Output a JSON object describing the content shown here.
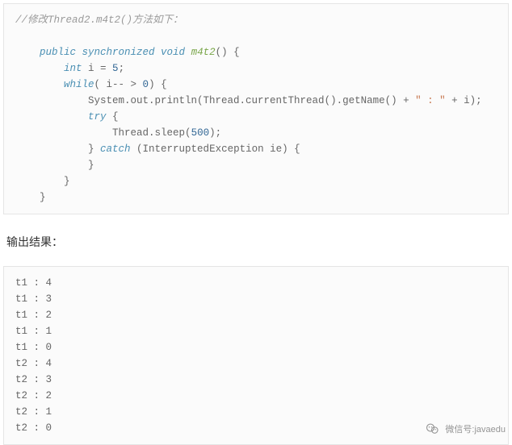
{
  "code_block_1": {
    "line1_comment": "//修改Thread2.m4t2()方法如下：",
    "sig_kw": "public synchronized void",
    "sig_fn": "m4t2",
    "sig_tail": "() {",
    "l2_kw": "int",
    "l2_rest": " i = ",
    "l2_num": "5",
    "l2_tail": ";",
    "l3_kw": "while",
    "l3_rest": "( i-- > ",
    "l3_num": "0",
    "l3_tail": ") {",
    "l4_text": "System.out.println(Thread.currentThread().getName() + ",
    "l4_str": "\" : \"",
    "l4_tail": " + i);",
    "l5_kw": "try",
    "l5_tail": " {",
    "l6_text": "Thread.sleep(",
    "l6_num": "500",
    "l6_tail": ");",
    "l7": "} ",
    "l7_kw": "catch",
    "l7_rest": " (InterruptedException ie) {",
    "l8": "}",
    "l9": "}",
    "l10": "}"
  },
  "result_label": "输出结果：",
  "output_lines": {
    "r0": "t1 : 4",
    "r1": "t1 : 3",
    "r2": "t1 : 2",
    "r3": "t1 : 1",
    "r4": "t1 : 0",
    "r5": "t2 : 4",
    "r6": "t2 : 3",
    "r7": "t2 : 2",
    "r8": "t2 : 1",
    "r9": "t2 : 0"
  },
  "watermark": {
    "label": "微信号:javaedu"
  }
}
